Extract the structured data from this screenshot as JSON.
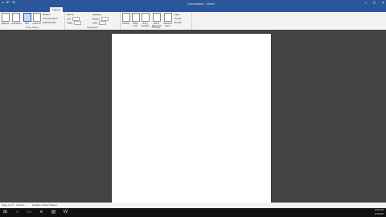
{
  "window": {
    "title": "Document1 - Word"
  },
  "ribbon": {
    "active_tab": "Layout",
    "groups": {
      "page_setup": {
        "label": "Page Setup",
        "buttons": [
          "Margins",
          "Orientation",
          "Size",
          "Columns"
        ],
        "small": [
          "Breaks",
          "Line Numbers",
          "Hyphenation"
        ]
      },
      "paragraph": {
        "label": "Paragraph",
        "indent_heading": "Indent",
        "spacing_heading": "Spacing",
        "left_label": "Left:",
        "left_value": "0\"",
        "right_label": "Right:",
        "right_value": "0\"",
        "before_label": "Before:",
        "before_value": "0 pt",
        "after_label": "After:",
        "after_value": "8 pt"
      },
      "arrange": {
        "label": "Arrange",
        "buttons": [
          "Position",
          "Wrap Text",
          "Bring Forward",
          "Send Backward",
          "Selection Pane"
        ],
        "small": [
          "Align",
          "Group",
          "Rotate"
        ]
      }
    }
  },
  "statusbar": {
    "page": "Page 1 of 1",
    "words": "0 words",
    "language": "English (United States)"
  },
  "taskbar": {
    "time": "9:09 PM",
    "date": "7/7/2016"
  }
}
